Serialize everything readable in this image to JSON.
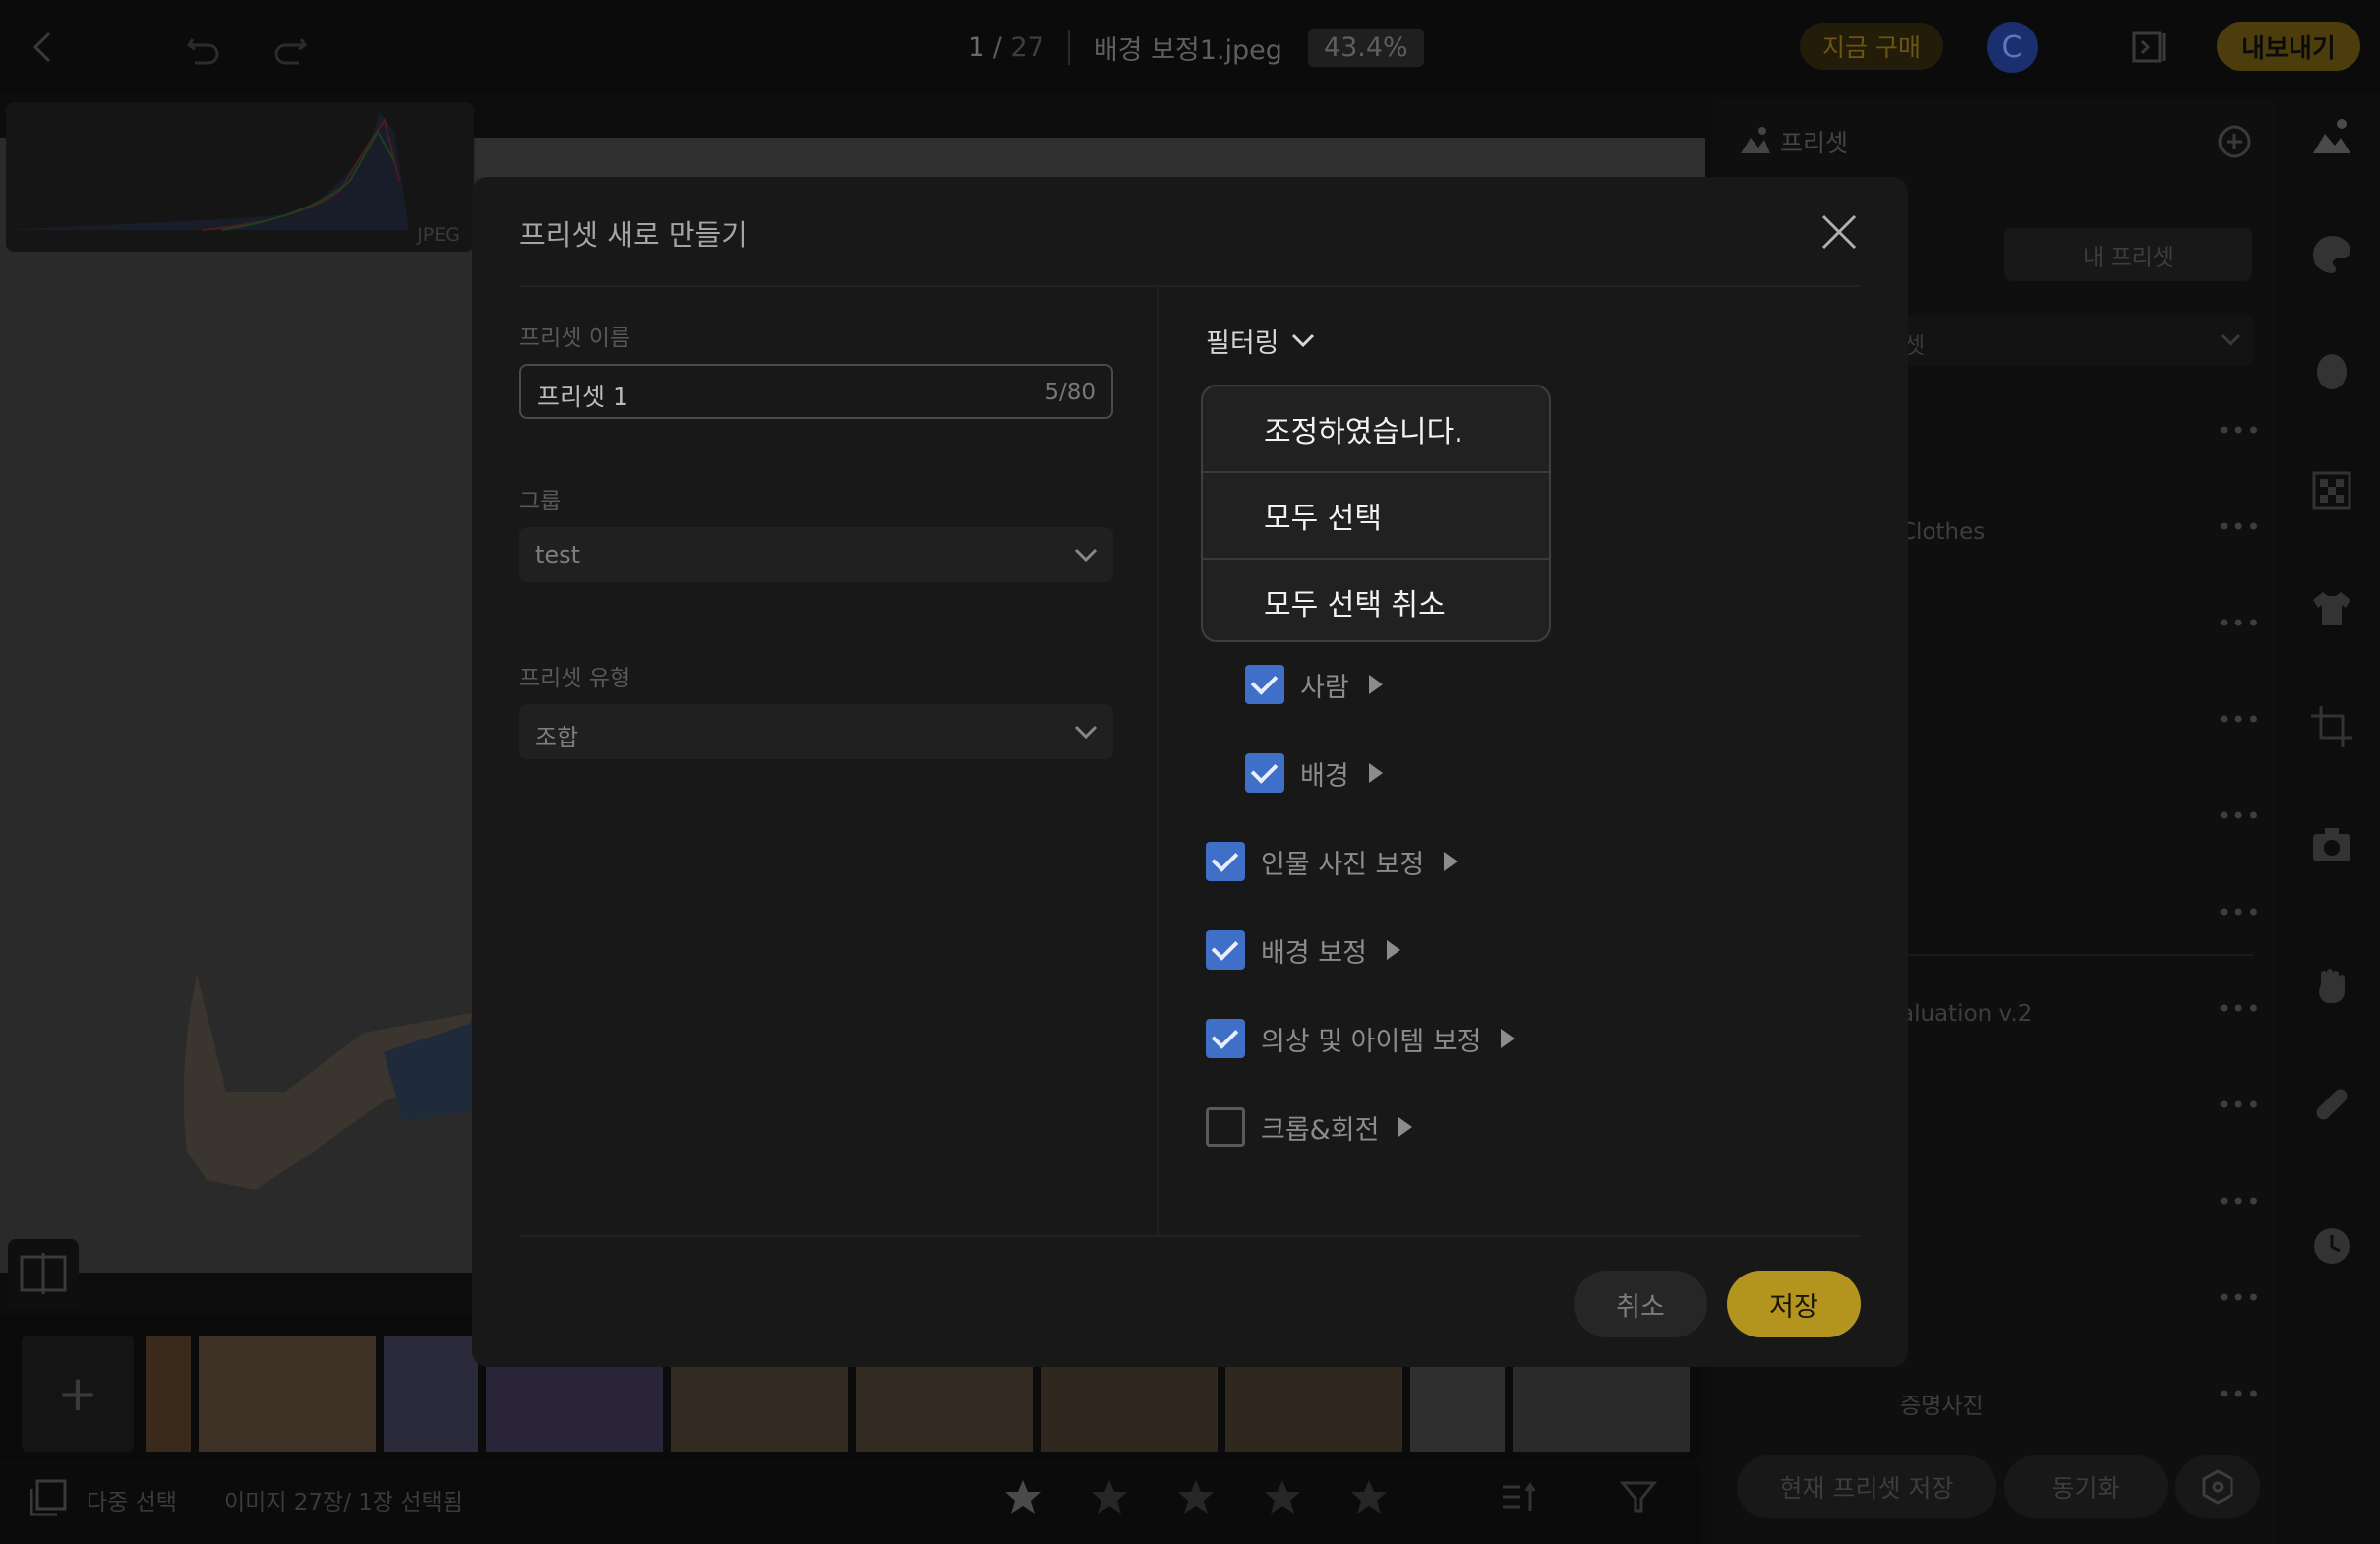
{
  "topbar": {
    "counter_current": "1",
    "counter_sep": " / ",
    "counter_total": "27",
    "filename": "배경 보정1.jpeg",
    "zoom": "43.4%",
    "buy_label": "지금 구매",
    "avatar_initial": "C",
    "export_label": "내보내기"
  },
  "histogram": {
    "label": "JPEG"
  },
  "bottombar": {
    "multi_select_label": "다중 선택",
    "image_count": "이미지 27장/ 1장 선택됨",
    "rating_stars": 5,
    "rating_value": 1
  },
  "right_panel": {
    "title": "프리셋",
    "tab_my_presets": "내 프리셋",
    "select_partial": "셋",
    "rows": [
      {
        "label": ""
      },
      {
        "label": "Clothes"
      },
      {
        "label": ""
      },
      {
        "label": ""
      },
      {
        "label": ""
      },
      {
        "label": ""
      },
      {
        "label": "aluation v.2"
      },
      {
        "label": ""
      },
      {
        "label": ""
      },
      {
        "label": ""
      },
      {
        "label": "증명사진"
      }
    ],
    "btn_save_current": "현재 프리셋 저장",
    "btn_sync": "동기화"
  },
  "modal": {
    "title": "프리셋 새로 만들기",
    "name_label": "프리셋 이름",
    "name_value": "프리셋 1",
    "name_counter": "5/80",
    "group_label": "그룹",
    "group_value": "test",
    "type_label": "프리셋 유형",
    "type_value": "조합",
    "filter_label": "필터링",
    "dropdown_items": [
      "조정하였습니다.",
      "모두 선택",
      "모두 선택 취소"
    ],
    "checkboxes": [
      {
        "label": "사람",
        "checked": true
      },
      {
        "label": "배경",
        "checked": true
      },
      {
        "label": "인물 사진 보정",
        "checked": true
      },
      {
        "label": "배경 보정",
        "checked": true
      },
      {
        "label": "의상 및 아이템 보정",
        "checked": true
      },
      {
        "label": "크롭&회전",
        "checked": false
      }
    ],
    "cancel_label": "취소",
    "save_label": "저장"
  },
  "colors": {
    "accent_gold": "#b3941f",
    "checkbox_blue": "#3f6fc6",
    "avatar_blue": "#1b2f6e"
  }
}
